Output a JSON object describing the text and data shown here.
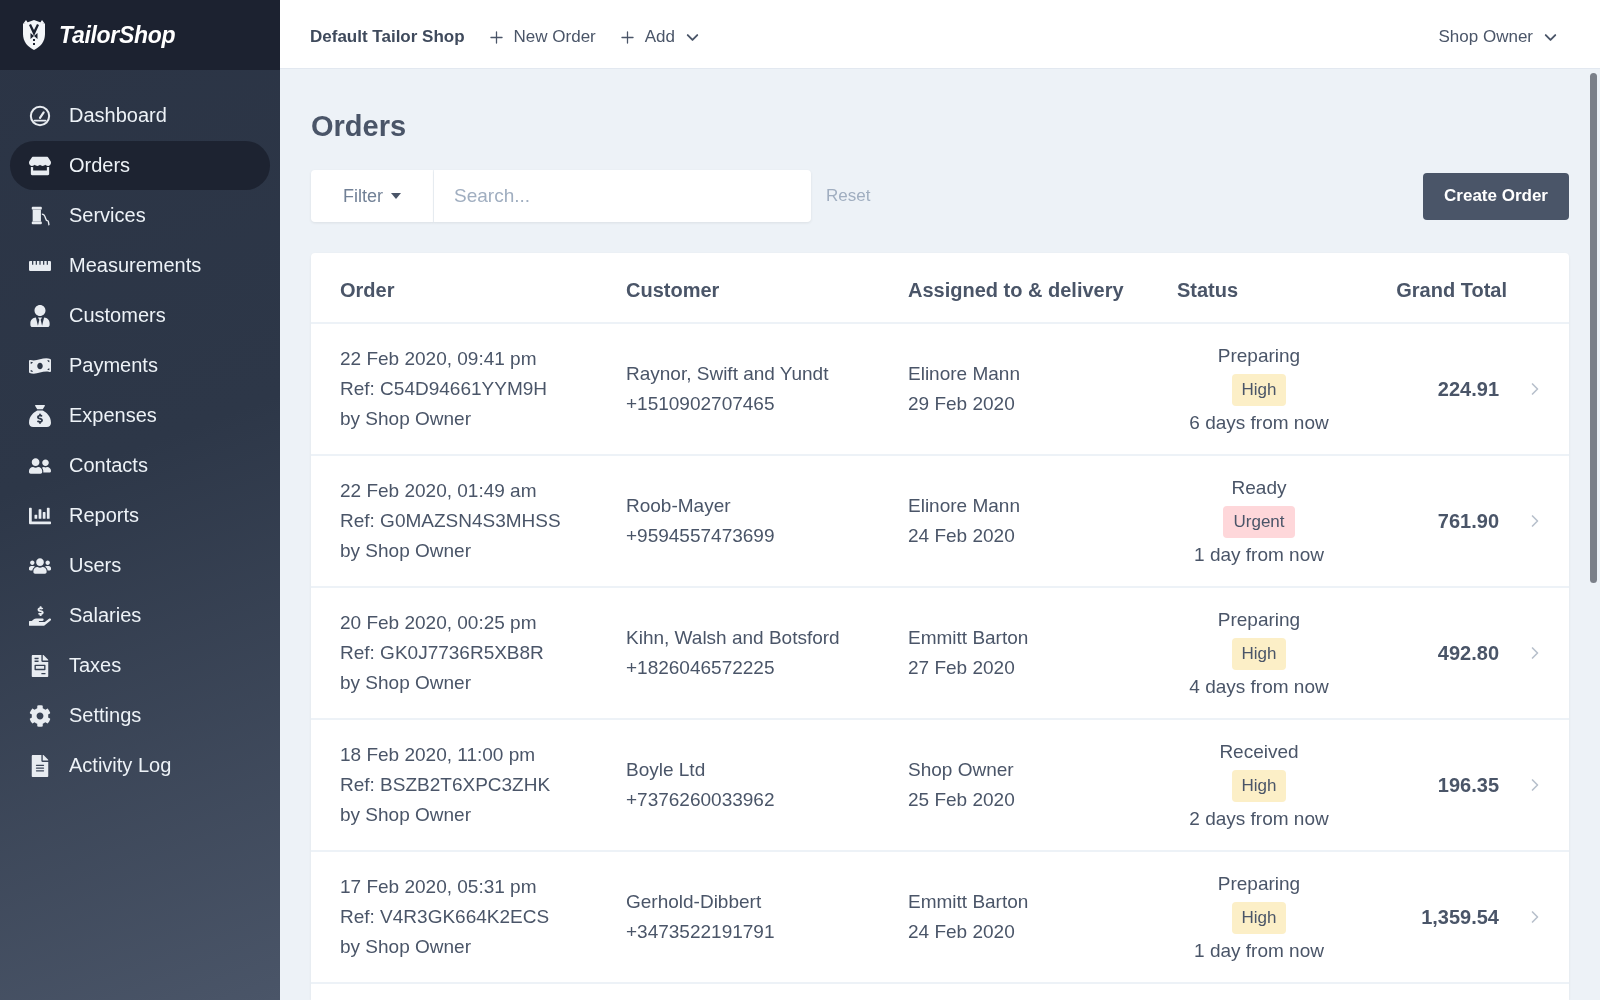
{
  "sidebar": {
    "brand": "TailorShop",
    "items": [
      {
        "label": "Dashboard",
        "selected": false
      },
      {
        "label": "Orders",
        "selected": true
      },
      {
        "label": "Services",
        "selected": false
      },
      {
        "label": "Measurements",
        "selected": false
      },
      {
        "label": "Customers",
        "selected": false
      },
      {
        "label": "Payments",
        "selected": false
      },
      {
        "label": "Expenses",
        "selected": false
      },
      {
        "label": "Contacts",
        "selected": false
      },
      {
        "label": "Reports",
        "selected": false
      },
      {
        "label": "Users",
        "selected": false
      },
      {
        "label": "Salaries",
        "selected": false
      },
      {
        "label": "Taxes",
        "selected": false
      },
      {
        "label": "Settings",
        "selected": false
      },
      {
        "label": "Activity Log",
        "selected": false
      }
    ]
  },
  "topbar": {
    "shop_name": "Default Tailor Shop",
    "actions": [
      {
        "label": "New Order",
        "dropdown": false
      },
      {
        "label": "Add",
        "dropdown": true
      }
    ],
    "user_menu": "Shop Owner"
  },
  "page": {
    "title": "Orders"
  },
  "filters": {
    "filter_button": "Filter",
    "search": {
      "placeholder": "Search..."
    },
    "reset": "Reset",
    "create_button": "Create Order"
  },
  "table": {
    "columns": [
      "Order",
      "Customer",
      "Assigned to & delivery",
      "Status",
      "Grand Total"
    ],
    "rows": [
      {
        "date": "22 Feb 2020, 09:41 pm",
        "ref": "Ref: C54D94661YYM9H",
        "created_by": "by Shop Owner",
        "customer": "Raynor, Swift and Yundt",
        "phone": "+1510902707465",
        "assignee": "Elinore Mann",
        "delivery": "29 Feb 2020",
        "status": "Preparing",
        "priority": {
          "label": "High",
          "color": "#fcefc7"
        },
        "due": "6 days from now",
        "total": "224.91"
      },
      {
        "date": "22 Feb 2020, 01:49 am",
        "ref": "Ref: G0MAZSN4S3MHSS",
        "created_by": "by Shop Owner",
        "customer": "Roob-Mayer",
        "phone": "+9594557473699",
        "assignee": "Elinore Mann",
        "delivery": "24 Feb 2020",
        "status": "Ready",
        "priority": {
          "label": "Urgent",
          "color": "#fed7da"
        },
        "due": "1 day from now",
        "total": "761.90"
      },
      {
        "date": "20 Feb 2020, 00:25 pm",
        "ref": "Ref: GK0J7736R5XB8R",
        "created_by": "by Shop Owner",
        "customer": "Kihn, Walsh and Botsford",
        "phone": "+1826046572225",
        "assignee": "Emmitt Barton",
        "delivery": "27 Feb 2020",
        "status": "Preparing",
        "priority": {
          "label": "High",
          "color": "#fcefc7"
        },
        "due": "4 days from now",
        "total": "492.80"
      },
      {
        "date": "18 Feb 2020, 11:00 pm",
        "ref": "Ref: BSZB2T6XPC3ZHK",
        "created_by": "by Shop Owner",
        "customer": "Boyle Ltd",
        "phone": "+7376260033962",
        "assignee": "Shop Owner",
        "delivery": "25 Feb 2020",
        "status": "Received",
        "priority": {
          "label": "High",
          "color": "#fcefc7"
        },
        "due": "2 days from now",
        "total": "196.35"
      },
      {
        "date": "17 Feb 2020, 05:31 pm",
        "ref": "Ref: V4R3GK664K2ECS",
        "created_by": "by Shop Owner",
        "customer": "Gerhold-Dibbert",
        "phone": "+3473522191791",
        "assignee": "Emmitt Barton",
        "delivery": "24 Feb 2020",
        "status": "Preparing",
        "priority": {
          "label": "High",
          "color": "#fcefc7"
        },
        "due": "1 day from now",
        "total": "1,359.54"
      }
    ]
  }
}
